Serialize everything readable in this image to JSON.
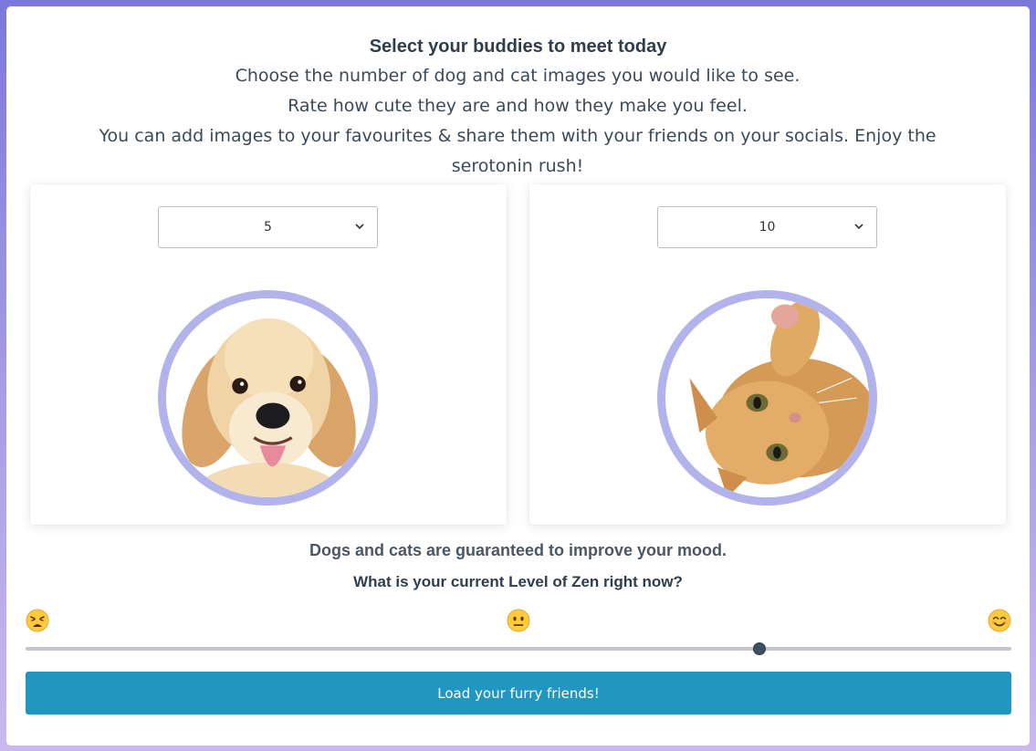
{
  "heading": {
    "title": "Select your buddies to meet today",
    "line1": "Choose the number of dog and cat images you would like to see.",
    "line2": "Rate how cute they are and how they make you feel.",
    "line3": "You can add images to your favourites & share them with your friends on your socials. Enjoy the serotonin rush!"
  },
  "dog_panel": {
    "count_selected": "5",
    "image": "golden-retriever-puppy"
  },
  "cat_panel": {
    "count_selected": "10",
    "image": "ginger-kitten"
  },
  "mood_text": "Dogs and cats are guaranteed to improve your mood.",
  "zen": {
    "question": "What is your current Level of Zen right now?",
    "emojis": [
      "weary-face-icon",
      "neutral-face-icon",
      "smiling-face-icon"
    ],
    "slider_value": 0.744
  },
  "load_button": "Load your furry friends!",
  "colors": {
    "accent": "#2196c1",
    "ring": "#b2b3ea",
    "text_dark": "#2f3e4c",
    "bg_top": "#7b78dc",
    "bg_bottom": "#cbb8ef"
  }
}
